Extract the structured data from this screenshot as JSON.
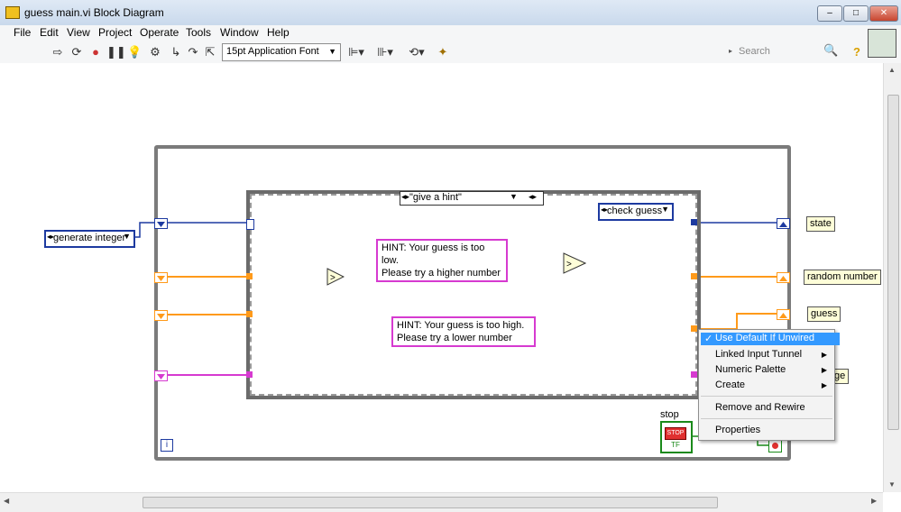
{
  "window": {
    "title": "guess main.vi Block Diagram",
    "min": "–",
    "max": "□",
    "close": "✕"
  },
  "menu": [
    "File",
    "Edit",
    "View",
    "Project",
    "Operate",
    "Tools",
    "Window",
    "Help"
  ],
  "toolbar": {
    "font": "15pt Application Font",
    "search_placeholder": "Search",
    "help": "?"
  },
  "diagram": {
    "case_selector": "\"give a hint\"",
    "enum_generate": "generate integer",
    "enum_check": "check guess",
    "hint_low": [
      "HINT: Your guess is too low.",
      "Please try a higher number"
    ],
    "hint_high": [
      "HINT: Your guess is too high.",
      "Please try a lower number"
    ],
    "indicators": {
      "state": "state",
      "random": "random number",
      "guess": "guess",
      "partial": "ge"
    },
    "stop_label": "stop",
    "stop_text": "STOP",
    "stop_tf": "TF",
    "info": "i"
  },
  "context_menu": {
    "items": [
      "Use Default If Unwired",
      "Linked Input Tunnel",
      "Numeric Palette",
      "Create",
      "Remove and Rewire",
      "Properties"
    ],
    "check": "✓"
  },
  "colors": {
    "enum_blue": "#1d3aa0",
    "numeric_orange": "#ff9a1a",
    "string_pink": "#d63ad0",
    "boolean_green": "#1a8a1a"
  }
}
